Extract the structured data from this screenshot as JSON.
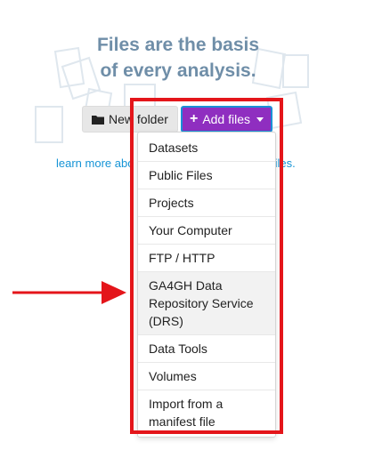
{
  "headline": {
    "line1": "Files are the basis",
    "line2": "of every analysis."
  },
  "toolbar": {
    "new_folder_label": "New folder",
    "add_files_label": "Add files"
  },
  "learn_more": {
    "text": "learn more abo",
    "tail": "files."
  },
  "dropdown": {
    "items": [
      {
        "label": "Datasets"
      },
      {
        "label": "Public Files"
      },
      {
        "label": "Projects"
      },
      {
        "label": "Your Computer"
      },
      {
        "label": "FTP / HTTP"
      },
      {
        "label": "GA4GH Data Repository Service (DRS)",
        "highlighted": true
      },
      {
        "label": "Data Tools"
      },
      {
        "label": "Volumes"
      },
      {
        "label": "Import from a manifest file"
      }
    ]
  },
  "colors": {
    "headline": "#6f8ea8",
    "add_button": "#8f2ec0",
    "link": "#1694d6",
    "annotation": "#e4151a"
  },
  "icons": {
    "folder": "folder-icon",
    "plus": "plus-icon",
    "caret": "caret-down-icon"
  }
}
